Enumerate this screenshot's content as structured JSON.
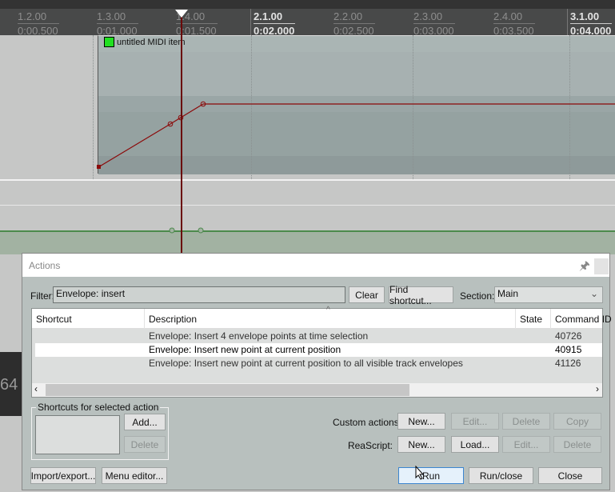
{
  "ruler": {
    "marks": [
      {
        "bar": "1.2.00",
        "time": "0:00.500",
        "major": false
      },
      {
        "bar": "1.3.00",
        "time": "0:01.000",
        "major": false
      },
      {
        "bar": "1.4.00",
        "time": "0:01.500",
        "major": false
      },
      {
        "bar": "2.1.00",
        "time": "0:02.000",
        "major": true
      },
      {
        "bar": "2.2.00",
        "time": "0:02.500",
        "major": false
      },
      {
        "bar": "2.3.00",
        "time": "0:03.000",
        "major": false
      },
      {
        "bar": "2.4.00",
        "time": "0:03.500",
        "major": false
      },
      {
        "bar": "3.1.00",
        "time": "0:04.000",
        "major": true
      }
    ]
  },
  "item": {
    "name": "untitled MIDI item",
    "icon": "midi-item-icon",
    "icon_color": "#21e021"
  },
  "envelope_color": "#8b0a0a",
  "track_number_partial": "64",
  "dialog": {
    "title": "Actions",
    "filter_label": "Filter:",
    "filter_value": "Envelope: insert",
    "clear": "Clear",
    "find_shortcut": "Find shortcut...",
    "section_label": "Section:",
    "section_value": "Main",
    "columns": [
      "Shortcut",
      "Description",
      "State",
      "Command ID"
    ],
    "rows": [
      {
        "shortcut": "",
        "description": "Envelope: Insert 4 envelope points at time selection",
        "state": "",
        "id": "40726",
        "selected": false
      },
      {
        "shortcut": "",
        "description": "Envelope: Insert new point at current position",
        "state": "",
        "id": "40915",
        "selected": true
      },
      {
        "shortcut": "",
        "description": "Envelope: Insert new point at current position to all visible track envelopes",
        "state": "",
        "id": "41126",
        "selected": false
      }
    ],
    "shortcuts_group": "Shortcuts for selected action",
    "add": "Add...",
    "delete": "Delete",
    "custom_actions_label": "Custom actions:",
    "custom": {
      "new": "New...",
      "edit": "Edit...",
      "delete": "Delete",
      "copy": "Copy"
    },
    "reascript_label": "ReaScript:",
    "reascript": {
      "new": "New...",
      "load": "Load...",
      "edit": "Edit...",
      "delete": "Delete"
    },
    "import_export": "Import/export...",
    "menu_editor": "Menu editor...",
    "run": "Run",
    "run_close": "Run/close",
    "close": "Close"
  }
}
